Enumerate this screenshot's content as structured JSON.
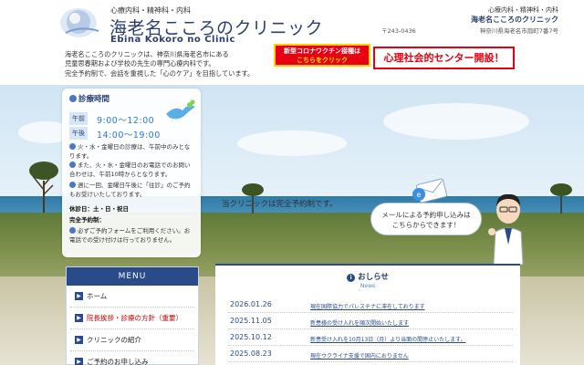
{
  "header": {
    "logo_sub": "心療内科・精神科・内科",
    "logo_title": "海老名こころのクリニック",
    "logo_en": "Ebina Kokoro no Clinic",
    "intro_lines": [
      "海老名こころのクリニックは、神奈川県海老名市にある",
      "児童思春期および学校の先生の専門心療内科です。",
      "完全予約制で、会話を重視した「心のケア」を目指しています。"
    ],
    "right_sub": "心療内科・精神科・内科",
    "right_name": "海老名こころのクリニック",
    "zip": "〒243-0436",
    "address": "神奈川県海老名市扇町7番7号",
    "covid_banner": [
      "新型コロナワクチン接種は",
      "こちらをクリック"
    ],
    "center_banner": "心理社会的センター開設！"
  },
  "hero": {
    "text": "当クリニックは完全予約制です。",
    "speech": [
      "メールによる予約申し込みは",
      "こちらからできます！"
    ]
  },
  "hours": {
    "title": "診療時間",
    "rows": [
      {
        "label": "午前",
        "time": "9:00～12:00"
      },
      {
        "label": "午後",
        "time": "14:00～19:00"
      }
    ],
    "notes": [
      "火・水・金曜日の診療は、午前中のみとなります。",
      "また、火・水・金曜日のお電話でのお問い合わせは、午前10時からとなります。",
      "週に一回、金曜日午後に「往診」のご予約もお受けいたしております。"
    ],
    "closed_label": "休診日：土・日・祝日",
    "reserve_label": "完全予約制：",
    "reserve_note": "必ずご予約フォームをご利用ください。お電話での受け付けは行っておりません。"
  },
  "menu": {
    "title": "MENU",
    "items": [
      {
        "label": "ホーム",
        "red": false
      },
      {
        "label": "院長挨拶・診療の方針（重要）",
        "red": true
      },
      {
        "label": "クリニックの紹介",
        "red": false
      },
      {
        "label": "ご予約のお申し込み",
        "red": false
      }
    ]
  },
  "news": {
    "title": "おしらせ",
    "sub": "News",
    "items": [
      {
        "date": "2026.01.26",
        "text": "現在国際協力でパレスチナに滞在しております"
      },
      {
        "date": "2025.11.05",
        "text": "新患様の受け入れを順次開始いたします"
      },
      {
        "date": "2025.10.12",
        "text": "新患受け入れを10月13日（月）より当面の間停止いたします。"
      },
      {
        "date": "2025.08.23",
        "text": "現在ウクライナ支援で国内におりません"
      }
    ]
  },
  "colors": {
    "navy": "#2a4a8a",
    "accent_red": "#e60012",
    "time_blue": "#2a7ad6"
  }
}
